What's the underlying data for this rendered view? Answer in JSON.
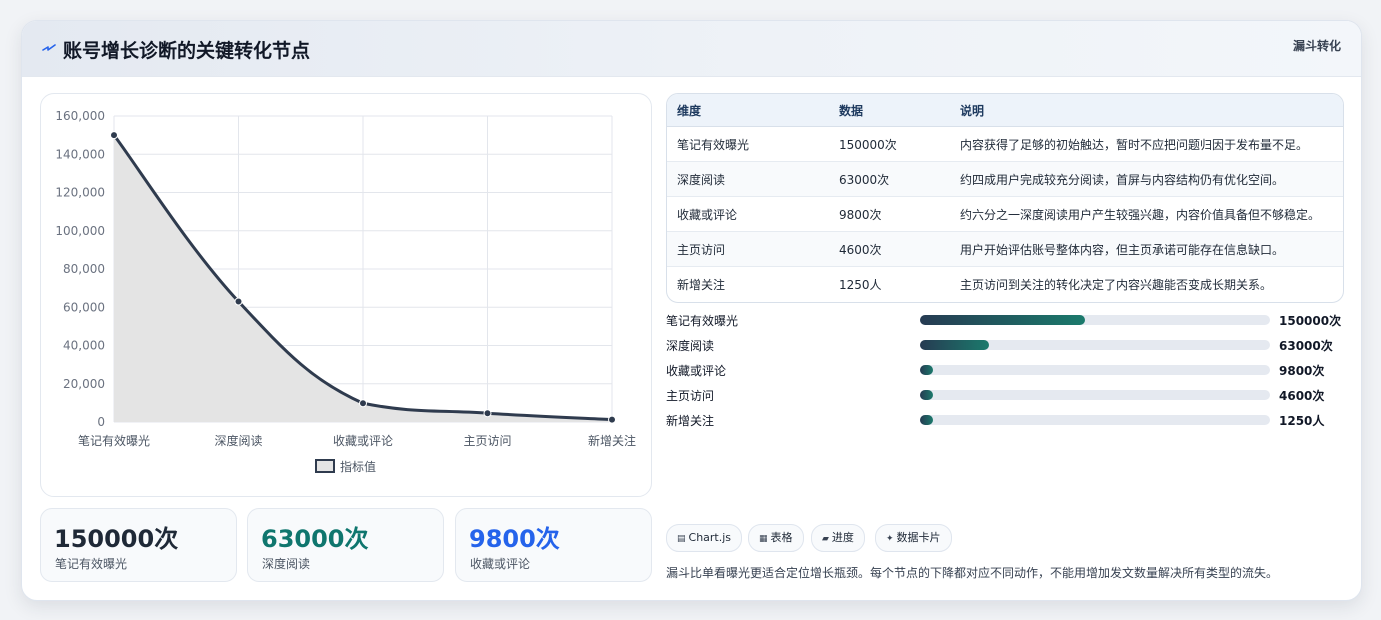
{
  "header": {
    "title": "账号增长诊断的关键转化节点",
    "tag": "漏斗转化",
    "icon": "bolt-icon"
  },
  "chart_data": {
    "type": "area",
    "categories": [
      "笔记有效曝光",
      "深度阅读",
      "收藏或评论",
      "主页访问",
      "新增关注"
    ],
    "series": [
      {
        "name": "指标值",
        "values": [
          150000,
          63000,
          9800,
          4600,
          1250
        ]
      }
    ],
    "ylim": [
      0,
      160000
    ],
    "yticks": [
      "0",
      "20,000",
      "40,000",
      "60,000",
      "80,000",
      "100,000",
      "120,000",
      "140,000",
      "160,000"
    ],
    "legend": "bottom",
    "grid": true,
    "colors": {
      "line": "#2f3b4e",
      "fill": "#e4e4e4"
    }
  },
  "stats": [
    {
      "value": "150000次",
      "label": "笔记有效曝光",
      "color": "#1f2937"
    },
    {
      "value": "63000次",
      "label": "深度阅读",
      "color": "#0f766e"
    },
    {
      "value": "9800次",
      "label": "收藏或评论",
      "color": "#2563eb"
    }
  ],
  "table": {
    "headers": [
      "维度",
      "数据",
      "说明"
    ],
    "rows": [
      [
        "笔记有效曝光",
        "150000次",
        "内容获得了足够的初始触达，暂时不应把问题归因于发布量不足。"
      ],
      [
        "深度阅读",
        "63000次",
        "约四成用户完成较充分阅读，首屏与内容结构仍有优化空间。"
      ],
      [
        "收藏或评论",
        "9800次",
        "约六分之一深度阅读用户产生较强兴趣，内容价值具备但不够稳定。"
      ],
      [
        "主页访问",
        "4600次",
        "用户开始评估账号整体内容，但主页承诺可能存在信息缺口。"
      ],
      [
        "新增关注",
        "1250人",
        "主页访问到关注的转化决定了内容兴趣能否变成长期关系。"
      ]
    ]
  },
  "progress": [
    {
      "label": "笔记有效曝光",
      "value": "150000次",
      "fraction": 0.47
    },
    {
      "label": "深度阅读",
      "value": "63000次",
      "fraction": 0.197
    },
    {
      "label": "收藏或评论",
      "value": "9800次",
      "fraction": 0.037
    },
    {
      "label": "主页访问",
      "value": "4600次",
      "fraction": 0.037
    },
    {
      "label": "新增关注",
      "value": "1250人",
      "fraction": 0.037
    }
  ],
  "pills": [
    {
      "icon": "▤",
      "label": "Chart.js"
    },
    {
      "icon": "▦",
      "label": "表格"
    },
    {
      "icon": "▰",
      "label": "进度"
    },
    {
      "icon": "✦",
      "label": "数据卡片"
    }
  ],
  "footnote": "漏斗比单看曝光更适合定位增长瓶颈。每个节点的下降都对应不同动作，不能用增加发文数量解决所有类型的流失。"
}
